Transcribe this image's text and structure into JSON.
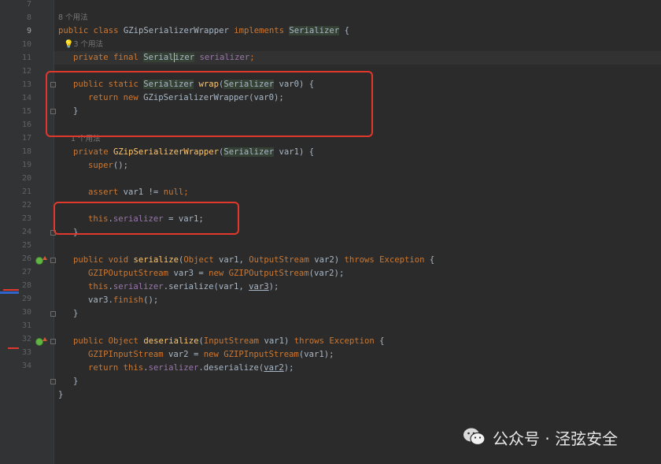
{
  "colors": {
    "editor_bg": "#2b2b2b",
    "keyword": "#cc7832",
    "method": "#ffc66d",
    "field": "#9876aa",
    "default_text": "#a9b7c6",
    "annotation_red": "#e0382c"
  },
  "hints": {
    "h8": "8 个用法",
    "h9": "3 个用法",
    "h15": "1 个用法"
  },
  "line_numbers": [
    "7",
    "8",
    "9",
    "10",
    "11",
    "12",
    "13",
    "14",
    "15",
    "16",
    "17",
    "18",
    "19",
    "20",
    "21",
    "22",
    "23",
    "24",
    "25",
    "26",
    "27",
    "28",
    "29",
    "30",
    "31",
    "32",
    "33",
    "34"
  ],
  "code": {
    "l8": {
      "kw1": "public class ",
      "name": "GZipSerializerWrapper",
      "kw2": " implements ",
      "iface": "Serializer",
      "rest": " {"
    },
    "l9": {
      "kw": "private final ",
      "t1": "Serial",
      "t2": "izer",
      "fld": " serializer",
      "end": ";"
    },
    "l11": {
      "kw": "public static ",
      "type": "Serializer",
      "sp": " ",
      "fn": "wrap",
      "p1": "(",
      "ptype": "Serializer",
      "p2": " var0) {"
    },
    "l12": {
      "kw": "return new ",
      "rest": "GZipSerializerWrapper(var0);"
    },
    "l13": {
      "text": "}"
    },
    "l15": {
      "kw": "private ",
      "fn": "GZipSerializerWrapper",
      "p1": "(",
      "ptype": "Serializer",
      "p2": " var1) {"
    },
    "l16": {
      "fn": "super",
      "rest": "();"
    },
    "l18": {
      "kw": "assert ",
      "mid": "var1 != ",
      "kw2": "null",
      "end": ";"
    },
    "l20": {
      "kw": "this",
      "dot": ".",
      "fld": "serializer",
      "rest": " = var1;"
    },
    "l21": {
      "text": "}"
    },
    "l23": {
      "kw": "public void ",
      "fn": "serialize",
      "p1": "(",
      "t1": "Object",
      "p2": " var1, ",
      "t2": "OutputStream",
      "p3": " var2) ",
      "kw2": "throws ",
      "t3": "Exception",
      "end": " {"
    },
    "l24": {
      "t1": "GZIPOutputStream",
      "mid": " var3 = ",
      "kw": "new ",
      "t2": "GZIPOutputStream",
      "end": "(var2);"
    },
    "l25": {
      "kw": "this",
      "dot": ".",
      "fld": "serializer",
      "mid": ".serialize(var1, ",
      "ul": "var3",
      "end": ");"
    },
    "l26": {
      "pre": "var3.",
      "fn": "finish",
      "end": "();"
    },
    "l27": {
      "text": "}"
    },
    "l29": {
      "kw": "public ",
      "t1": "Object",
      "sp": " ",
      "fn": "deserialize",
      "p1": "(",
      "t2": "InputStream",
      "p2": " var1) ",
      "kw2": "throws ",
      "t3": "Exception",
      "end": " {"
    },
    "l30": {
      "t1": "GZIPInputStream",
      "mid": " var2 = ",
      "kw": "new ",
      "t2": "GZIPInputStream",
      "end": "(var1);"
    },
    "l31": {
      "kw": "return this",
      "dot": ".",
      "fld": "serializer",
      "mid": ".deserialize(",
      "ul": "var2",
      "end": ");"
    },
    "l32": {
      "text": "}"
    },
    "l33": {
      "text": "}"
    }
  },
  "watermark": {
    "text": "公众号 · 泾弦安全"
  },
  "icons": {
    "bulb": "lightbulb-icon",
    "implement": "implements-method-icon",
    "fold": "fold-marker-icon",
    "wechat": "wechat-icon"
  }
}
